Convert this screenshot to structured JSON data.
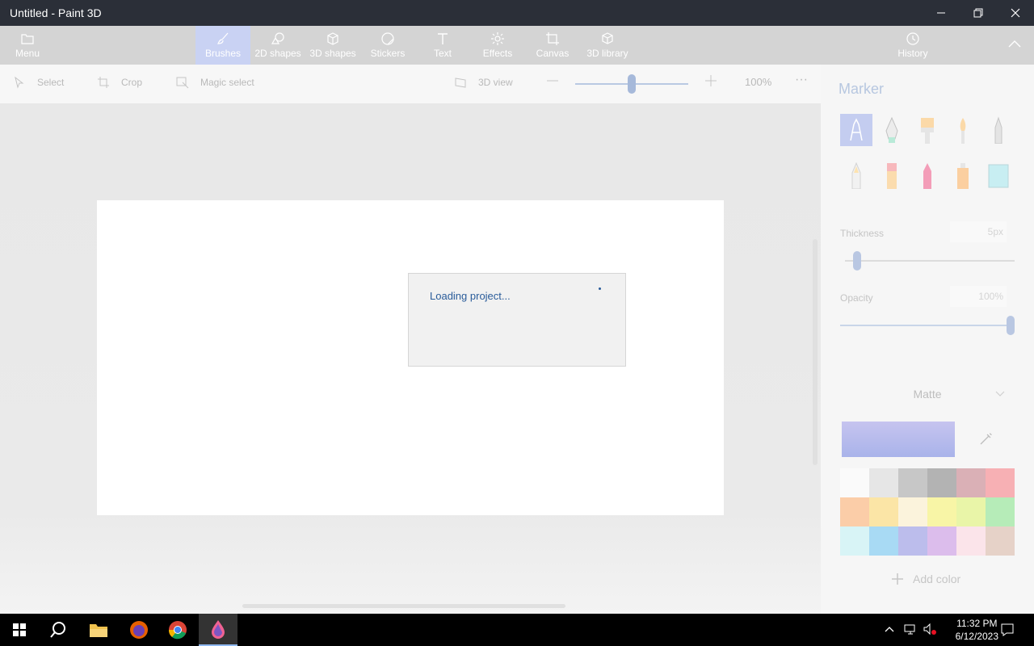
{
  "window": {
    "title": "Untitled - Paint 3D"
  },
  "ribbon": {
    "menu_label": "Menu",
    "tools": [
      {
        "label": "Brushes",
        "icon": "brush-icon",
        "active": true
      },
      {
        "label": "2D shapes",
        "icon": "2d-shapes-icon"
      },
      {
        "label": "3D shapes",
        "icon": "3d-shapes-icon"
      },
      {
        "label": "Stickers",
        "icon": "stickers-icon"
      },
      {
        "label": "Text",
        "icon": "text-icon"
      },
      {
        "label": "Effects",
        "icon": "effects-icon"
      },
      {
        "label": "Canvas",
        "icon": "canvas-icon"
      },
      {
        "label": "3D library",
        "icon": "3d-library-icon"
      }
    ],
    "history_label": "History"
  },
  "toolbar": {
    "select_label": "Select",
    "crop_label": "Crop",
    "magic_select_label": "Magic select",
    "view3d_label": "3D view",
    "zoom_value": "100%",
    "zoom_fraction": 0.5
  },
  "canvas": {
    "loading_text": "Loading project..."
  },
  "panel": {
    "title": "Marker",
    "thickness_label": "Thickness",
    "thickness_value": "5px",
    "thickness_fraction": 0.05,
    "opacity_label": "Opacity",
    "opacity_value": "100%",
    "opacity_fraction": 1.0,
    "finish": "Matte",
    "add_color_label": "Add color",
    "palette": [
      "#fafafa",
      "#e6e6e6",
      "#c7c7c7",
      "#b3b3b3",
      "#dab0b6",
      "#f7b0b4",
      "#fbcda8",
      "#fbe5a6",
      "#fbf3dc",
      "#f8f5a6",
      "#e9f5a8",
      "#b6ecb8",
      "#d8f4f6",
      "#a8daf4",
      "#bcbdec",
      "#dcbdec",
      "#fbe4ea",
      "#e6d2c8"
    ]
  },
  "taskbar": {
    "time": "11:32 PM",
    "date": "6/12/2023"
  }
}
